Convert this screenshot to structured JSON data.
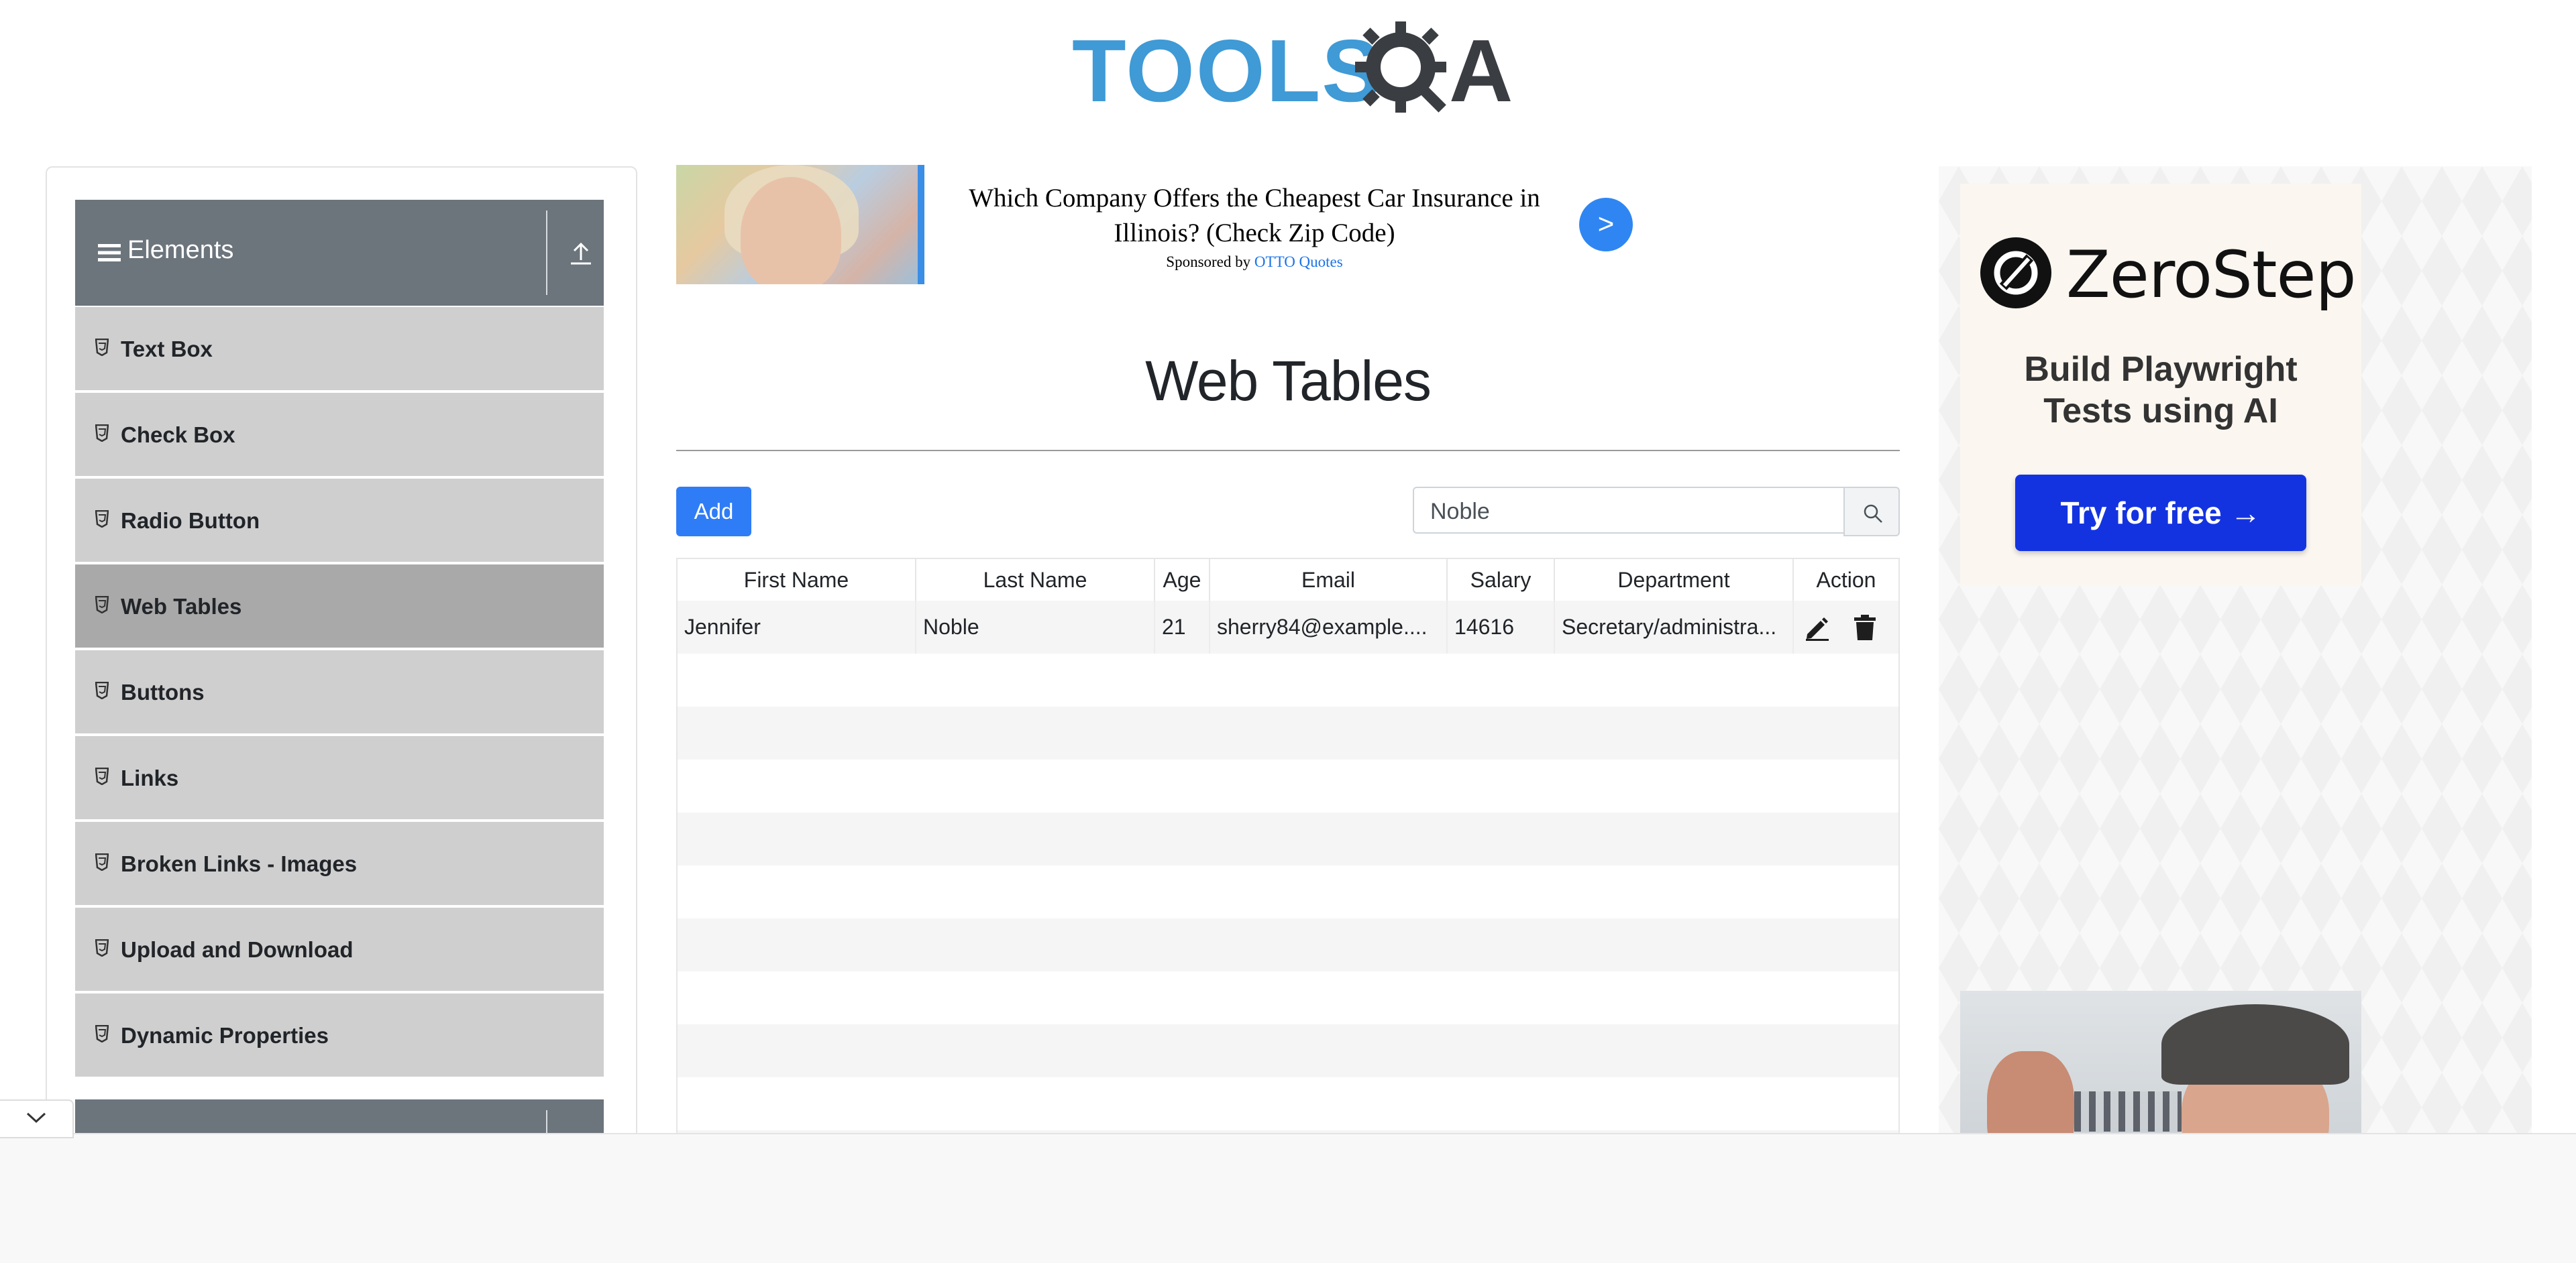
{
  "header": {
    "logo_text_left": "TOOLS",
    "logo_text_right": "A"
  },
  "sidebar": {
    "group_title": "Elements",
    "items": [
      {
        "label": "Text Box",
        "active": false
      },
      {
        "label": "Check Box",
        "active": false
      },
      {
        "label": "Radio Button",
        "active": false
      },
      {
        "label": "Web Tables",
        "active": true
      },
      {
        "label": "Buttons",
        "active": false
      },
      {
        "label": "Links",
        "active": false
      },
      {
        "label": "Broken Links - Images",
        "active": false
      },
      {
        "label": "Upload and Download",
        "active": false
      },
      {
        "label": "Dynamic Properties",
        "active": false
      }
    ]
  },
  "ad_banner": {
    "headline": "Which Company Offers the Cheapest Car Insurance in Illinois? (Check Zip Code)",
    "sponsor_prefix": "Sponsored by",
    "sponsor_brand": "OTTO Quotes",
    "arrow": ">"
  },
  "main": {
    "title": "Web Tables",
    "add_label": "Add",
    "search_value": "Noble",
    "table": {
      "headers": [
        "First Name",
        "Last Name",
        "Age",
        "Email",
        "Salary",
        "Department",
        "Action"
      ],
      "rows": [
        {
          "first_name": "Jennifer",
          "last_name": "Noble",
          "age": "21",
          "email": "sherry84@example....",
          "salary": "14616",
          "department": "Secretary/administra..."
        }
      ]
    }
  },
  "right_ad": {
    "brand": "ZeroStep",
    "tagline_line1": "Build Playwright",
    "tagline_line2": "Tests using AI",
    "cta": "Try for free →"
  },
  "colors": {
    "accent": "#2f7df6",
    "sidebar_header": "#6c747c",
    "sidebar_item": "#cfcfcf",
    "sidebar_item_active": "#a9a9a9",
    "logo_blue": "#3f9ad6",
    "logo_dark": "#3a3d42",
    "zerostep_blue": "#1433e0"
  }
}
